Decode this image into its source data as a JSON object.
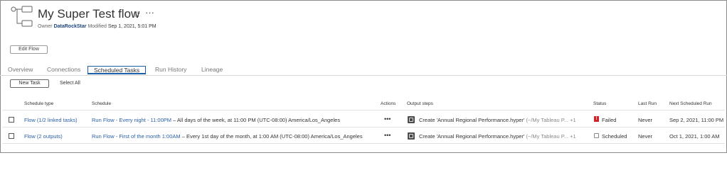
{
  "flow": {
    "title": "My Super Test flow",
    "owner_label": "Owner",
    "owner_name": "DataRockStar",
    "modified_label": "Modified",
    "modified_value": "Sep 1, 2021, 5:01 PM",
    "star_icon": "star-outline-icon",
    "more_icon": "more-horizontal-icon",
    "edit_label": "Edit Flow"
  },
  "tabs": [
    {
      "label": "Overview",
      "active": false
    },
    {
      "label": "Connections",
      "active": false
    },
    {
      "label": "Scheduled Tasks",
      "active": true
    },
    {
      "label": "Run History",
      "active": false
    },
    {
      "label": "Lineage",
      "active": false
    }
  ],
  "toolbar": {
    "new_task_label": "New Task",
    "select_all_label": "Select All"
  },
  "table": {
    "headers": {
      "schedule_type": "Schedule type",
      "schedule": "Schedule",
      "actions": "Actions",
      "output_steps": "Output steps",
      "status": "Status",
      "last_run": "Last Run",
      "next_run": "Next Scheduled Run"
    },
    "rows": [
      {
        "schedule_type": "Flow (1/2 linked tasks)",
        "schedule_link": "Run Flow - Every night - 11:00PM",
        "schedule_desc": " – All days of the week, at 11:00 PM (UTC-08:00) America/Los_Angeles",
        "actions": "•••",
        "output_text": "Create 'Annual Regional Performance.hyper'",
        "output_path": "(~/My Tableau P...",
        "output_more": "+1",
        "status": "Failed",
        "status_icon": "failed-icon",
        "last_run": "Never",
        "next_run": "Sep 2, 2021, 11:00 PM"
      },
      {
        "schedule_type": "Flow (2 outputs)",
        "schedule_link": "Run Flow - First of the month 1:00AM",
        "schedule_desc": " – Every 1st day of the month, at 1:00 AM (UTC-08:00) America/Los_Angeles",
        "actions": "•••",
        "output_text": "Create 'Annual Regional Performance.hyper'",
        "output_path": "(~/My Tableau P...",
        "output_more": "+1",
        "status": "Scheduled",
        "status_icon": "scheduled-icon",
        "last_run": "Never",
        "next_run": "Oct 1, 2021, 1:00 AM"
      }
    ]
  }
}
